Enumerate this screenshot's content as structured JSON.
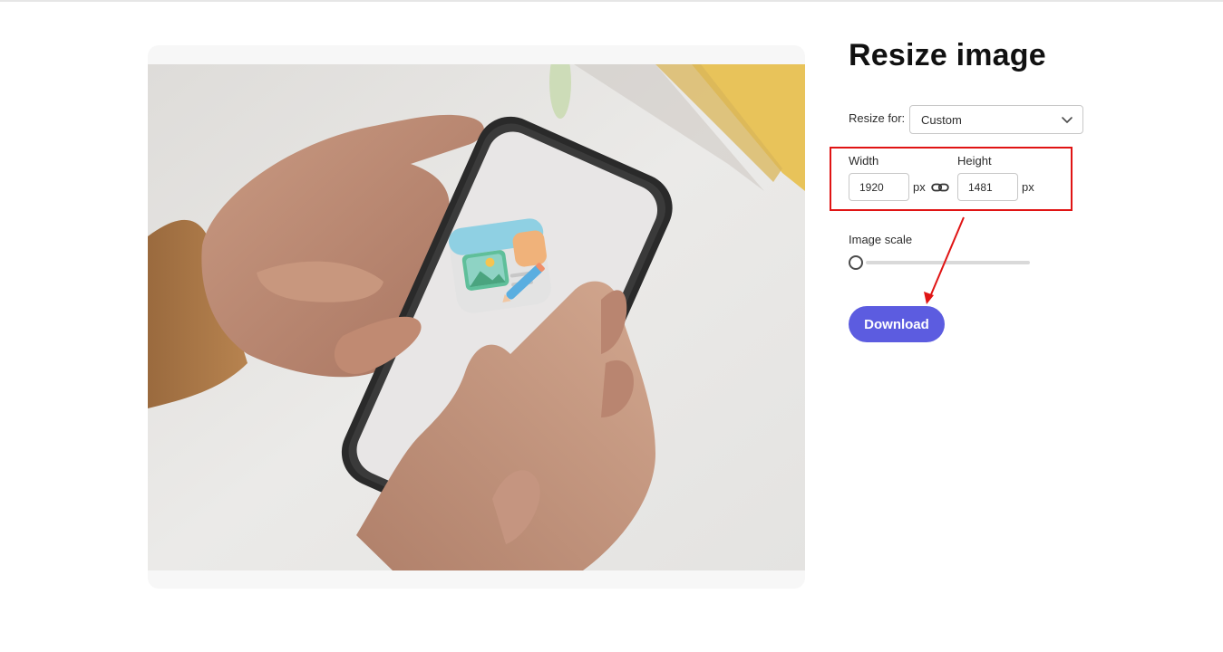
{
  "page": {
    "title": "Resize image"
  },
  "resize_for": {
    "label": "Resize for:",
    "selected": "Custom"
  },
  "dimensions": {
    "width_label": "Width",
    "width_value": "1920",
    "height_label": "Height",
    "height_value": "1481",
    "unit": "px"
  },
  "image_scale": {
    "label": "Image scale",
    "level": 0
  },
  "download": {
    "label": "Download"
  },
  "icons": {
    "dropdown": "chevron-down-icon",
    "lock_aspect": "link-icon",
    "app": "image-editor-app-icon"
  },
  "colors": {
    "accent": "#5c5ce0",
    "annotation": "#e01414"
  }
}
